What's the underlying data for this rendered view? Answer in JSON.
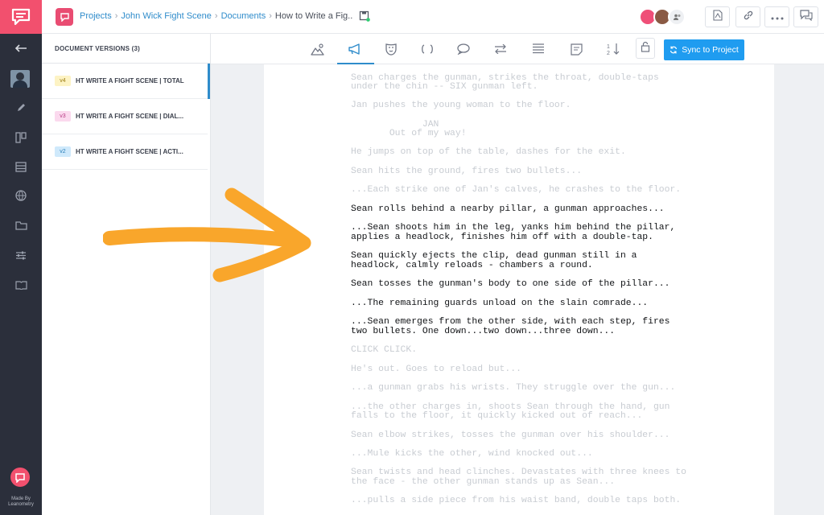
{
  "colors": {
    "brand": "#f2506e",
    "accent": "#2f8ccb",
    "sync_button": "#1f9cf0",
    "rail": "#2b2f3b",
    "arrow": "#f9a62b"
  },
  "rail": {
    "logo_icon": "speech-bubble-logo-icon",
    "items": [
      "back-arrow-icon",
      "avatar",
      "pencil-icon",
      "columns-icon",
      "list-icon",
      "sphere-icon",
      "folder-icon",
      "sliders-icon",
      "book-icon"
    ],
    "made_by_line1": "Made By",
    "made_by_line2": "Leanometry"
  },
  "header": {
    "breadcrumb": [
      "Projects",
      "John Wick Fight Scene",
      "Documents"
    ],
    "current": "How to Write a Fig..",
    "buttons": [
      "pdf-icon",
      "link-icon",
      "more-icon",
      "comments-icon"
    ]
  },
  "versions": {
    "title": "DOCUMENT VERSIONS (3)",
    "items": [
      {
        "tag": "v4",
        "label": "HT WRITE A FIGHT SCENE | TOTAL",
        "tag_bg": "#fdf3c4",
        "tag_color": "#9a7b10"
      },
      {
        "tag": "v3",
        "label": "HT WRITE A FIGHT SCENE | DIAL...",
        "tag_bg": "#fbd9ee",
        "tag_color": "#b73a84"
      },
      {
        "tag": "v2",
        "label": "HT WRITE A FIGHT SCENE | ACTI...",
        "tag_bg": "#cfe9fb",
        "tag_color": "#2a7fb8"
      }
    ]
  },
  "toolbar": {
    "tools": [
      "scene-icon",
      "megaphone-icon",
      "mask-icon",
      "shape-icon",
      "chat-icon",
      "swap-icon",
      "lines-icon",
      "note-icon",
      "sort-icon"
    ],
    "sync_label": "Sync to Project"
  },
  "script": {
    "lines": [
      {
        "text": "Sean charges the gunman, strikes the throat, double-taps",
        "hi": false
      },
      {
        "text": "under the chin -- SIX gunman left.",
        "hi": false
      },
      {
        "text": "Jan pushes the young woman to the floor.",
        "hi": false
      },
      {
        "text": "             JAN",
        "hi": false
      },
      {
        "text": "       Out of my way!",
        "hi": false
      },
      {
        "text": "He jumps on top of the table, dashes for the exit.",
        "hi": false
      },
      {
        "text": "Sean hits the ground, fires two bullets...",
        "hi": false
      },
      {
        "text": "...Each strike one of Jan's calves, he crashes to the floor.",
        "hi": false
      },
      {
        "text": "Sean rolls behind a nearby pillar, a gunman approaches...",
        "hi": true
      },
      {
        "text": "...Sean shoots him in the leg, yanks him behind the pillar,",
        "hi": true
      },
      {
        "text": "applies a headlock, finishes him off with a double-tap.",
        "hi": true
      },
      {
        "text": "Sean quickly ejects the clip, dead gunman still in a",
        "hi": true
      },
      {
        "text": "headlock, calmly reloads - chambers a round.",
        "hi": true
      },
      {
        "text": "Sean tosses the gunman's body to one side of the pillar...",
        "hi": true
      },
      {
        "text": "...The remaining guards unload on the slain comrade...",
        "hi": true
      },
      {
        "text": "...Sean emerges from the other side, with each step, fires",
        "hi": true
      },
      {
        "text": "two bullets. One down...two down...three down...",
        "hi": true
      },
      {
        "text": "CLICK CLICK.",
        "hi": false
      },
      {
        "text": "He's out. Goes to reload but...",
        "hi": false
      },
      {
        "text": "...a gunman grabs his wrists. They struggle over the gun...",
        "hi": false
      },
      {
        "text": "...the other charges in, shoots Sean through the hand, gun",
        "hi": false
      },
      {
        "text": "falls to the floor, it quickly kicked out of reach...",
        "hi": false
      },
      {
        "text": "Sean elbow strikes, tosses the gunman over his shoulder...",
        "hi": false
      },
      {
        "text": "...Mule kicks the other, wind knocked out...",
        "hi": false
      },
      {
        "text": "Sean twists and head clinches. Devastates with three knees to",
        "hi": false
      },
      {
        "text": "the face - the other gunman stands up as Sean...",
        "hi": false
      },
      {
        "text": "...pulls a side piece from his waist band, double taps both.",
        "hi": false
      }
    ]
  }
}
